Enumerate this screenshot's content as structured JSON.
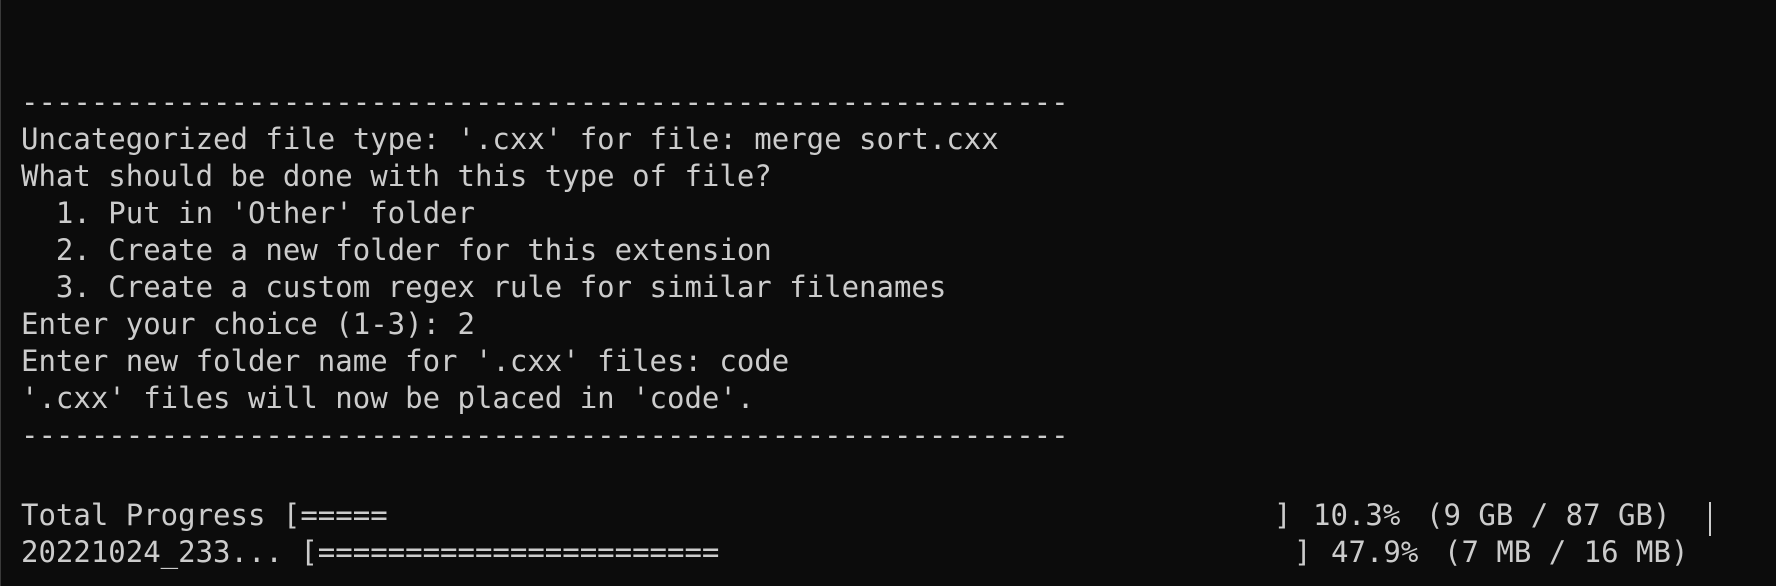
{
  "terminal": {
    "separator_top": "------------------------------------------------------------",
    "line_uncategorized": "Uncategorized file type: '.cxx' for file: merge sort.cxx",
    "line_question": "What should be done with this type of file?",
    "options": [
      "  1. Put in 'Other' folder",
      "  2. Create a new folder for this extension",
      "  3. Create a custom regex rule for similar filenames"
    ],
    "line_choice": "Enter your choice (1-3): 2",
    "line_folder_name": "Enter new folder name for '.cxx' files: code",
    "line_result": "'.cxx' files will now be placed in 'code'.",
    "separator_bottom": "------------------------------------------------------------"
  },
  "progress": {
    "total": {
      "label_bar": "Total Progress [=====",
      "close_bracket": "]",
      "percent": "10.3%",
      "detail": "(9 GB / 87 GB)",
      "fraction": 0.103
    },
    "file": {
      "label_bar": "20221024_233... [=======================",
      "close_bracket": "]",
      "percent": "47.9%",
      "detail": "(7 MB / 16 MB)",
      "fraction": 0.479
    }
  },
  "colors": {
    "background": "#0c0c0c",
    "foreground": "#cccccc"
  }
}
